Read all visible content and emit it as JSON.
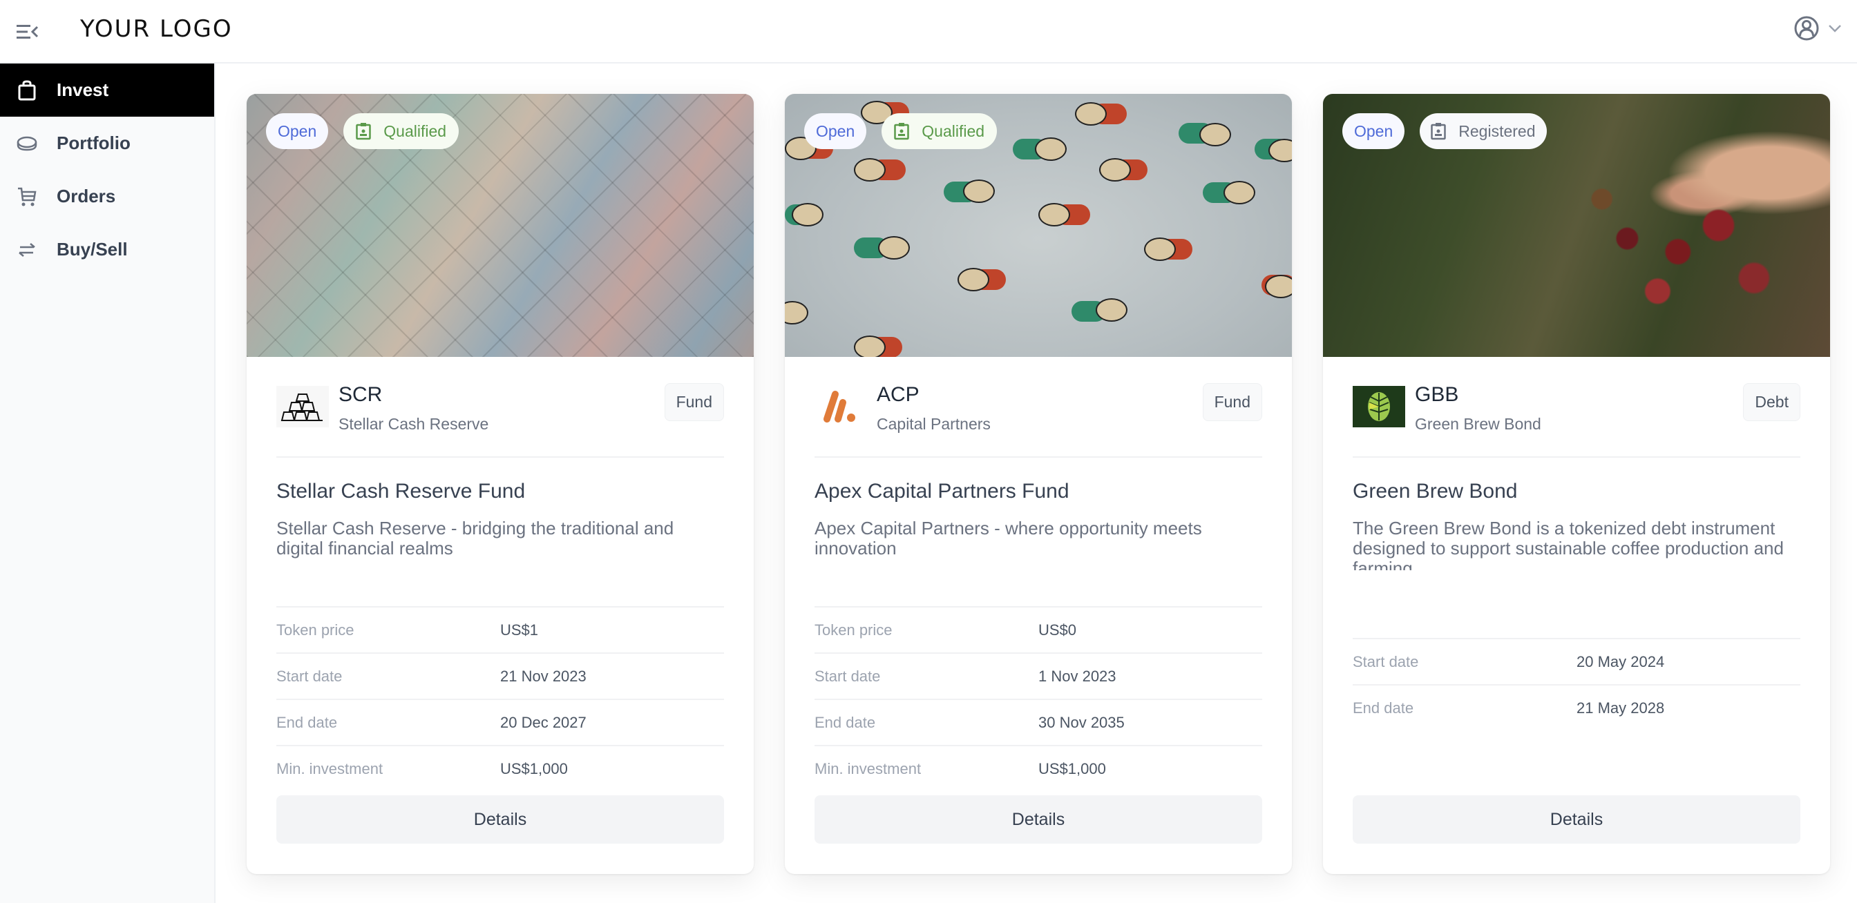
{
  "header": {
    "logo_text": "YOUR LOGO",
    "menu_icon": "menu-collapse-icon",
    "user_icon": "user-circle-icon",
    "user_chevron": "chevron-down-icon"
  },
  "sidebar": {
    "items": [
      {
        "label": "Invest",
        "icon": "shopping-bag-icon",
        "active": true
      },
      {
        "label": "Portfolio",
        "icon": "coins-icon",
        "active": false
      },
      {
        "label": "Orders",
        "icon": "cart-icon",
        "active": false
      },
      {
        "label": "Buy/Sell",
        "icon": "swap-arrows-icon",
        "active": false
      }
    ]
  },
  "colors": {
    "active_nav_bg": "#000000",
    "open_badge_text": "#4f6bd8",
    "qualified_badge_text": "#5a9a4a",
    "registered_badge_text": "#6b7280",
    "acp_logo": "#e07b39",
    "gbb_logo_bg": "#1e3a1a"
  },
  "cards": [
    {
      "badges": {
        "status": "Open",
        "access": "Qualified",
        "access_icon": "clipboard-user-icon"
      },
      "code": "SCR",
      "name": "Stellar Cash Reserve",
      "type": "Fund",
      "logo": "gold-bars-logo",
      "title": "Stellar Cash Reserve Fund",
      "description": "Stellar Cash Reserve - bridging the traditional and digital financial realms",
      "details": [
        {
          "label": "Token price",
          "value": "US$1"
        },
        {
          "label": "Start date",
          "value": "21 Nov 2023"
        },
        {
          "label": "End date",
          "value": "20 Dec 2027"
        },
        {
          "label": "Min. investment",
          "value": "US$1,000"
        }
      ],
      "button": "Details"
    },
    {
      "badges": {
        "status": "Open",
        "access": "Qualified",
        "access_icon": "clipboard-user-icon"
      },
      "code": "ACP",
      "name": "Capital Partners",
      "type": "Fund",
      "logo": "acp-logo",
      "title": "Apex Capital Partners Fund",
      "description": "Apex Capital Partners - where opportunity meets innovation",
      "details": [
        {
          "label": "Token price",
          "value": "US$0"
        },
        {
          "label": "Start date",
          "value": "1 Nov 2023"
        },
        {
          "label": "End date",
          "value": "30 Nov 2035"
        },
        {
          "label": "Min. investment",
          "value": "US$1,000"
        }
      ],
      "button": "Details"
    },
    {
      "badges": {
        "status": "Open",
        "access": "Registered",
        "access_icon": "clipboard-user-icon"
      },
      "code": "GBB",
      "name": "Green Brew Bond",
      "type": "Debt",
      "logo": "leaf-logo",
      "title": "Green Brew Bond",
      "description": "The Green Brew Bond is a tokenized debt instrument designed to support sustainable coffee production and farming",
      "details": [
        {
          "label": "Start date",
          "value": "20 May 2024"
        },
        {
          "label": "End date",
          "value": "21 May 2028"
        }
      ],
      "button": "Details"
    }
  ]
}
